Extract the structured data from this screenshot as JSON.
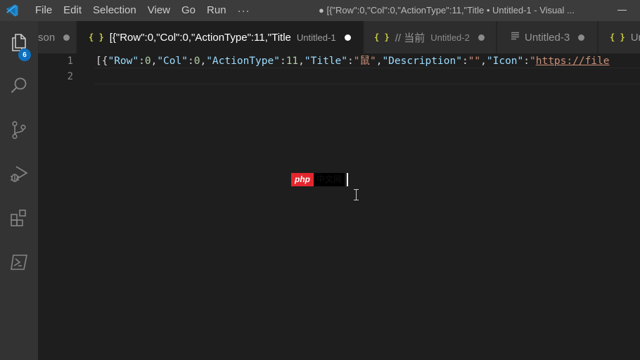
{
  "titlebar": {
    "menu": [
      "File",
      "Edit",
      "Selection",
      "View",
      "Go",
      "Run"
    ],
    "more": "···",
    "window_title": "● [{\"Row\":0,\"Col\":0,\"ActionType\":11,\"Title • Untitled-1 - Visual ..."
  },
  "activity": {
    "explorer_badge": "6"
  },
  "tabs": [
    {
      "title": "son",
      "desc": "",
      "dirty": true
    },
    {
      "title": "[{\"Row\":0,\"Col\":0,\"ActionType\":11,\"Title",
      "desc": "Untitled-1",
      "dirty": true,
      "active": true
    },
    {
      "title": "// 当前",
      "desc": "Untitled-2",
      "dirty": true
    },
    {
      "title": "Untitled-3",
      "desc": "",
      "dirty": true
    },
    {
      "title": "Un",
      "desc": "",
      "dirty": false
    }
  ],
  "editor": {
    "line_numbers": [
      "1",
      "2"
    ],
    "line1": {
      "t1": "[{",
      "k_row": "\"Row\"",
      "c1": ":",
      "n_row": "0",
      "c2": ",",
      "k_col": "\"Col\"",
      "c3": ":",
      "n_col": "0",
      "c4": ",",
      "k_action": "\"ActionType\"",
      "c5": ":",
      "n_action": "11",
      "c6": ",",
      "k_title": "\"Title\"",
      "c7": ":",
      "s_title": "\"鼠\"",
      "c8": ",",
      "k_desc": "\"Description\"",
      "c9": ":",
      "s_desc": "\"\"",
      "c10": ",",
      "k_icon": "\"Icon\"",
      "c11": ":",
      "s_icon_q": "\"",
      "s_icon_url": "https://file"
    },
    "line2": ""
  },
  "watermark": {
    "php": "php",
    "cn": "中文网"
  },
  "colors": {
    "accent": "#0e70c0",
    "json_icon": "#cbcb41",
    "json_key": "#9cdcfe",
    "json_string": "#ce9178",
    "json_number": "#b5cea8"
  }
}
